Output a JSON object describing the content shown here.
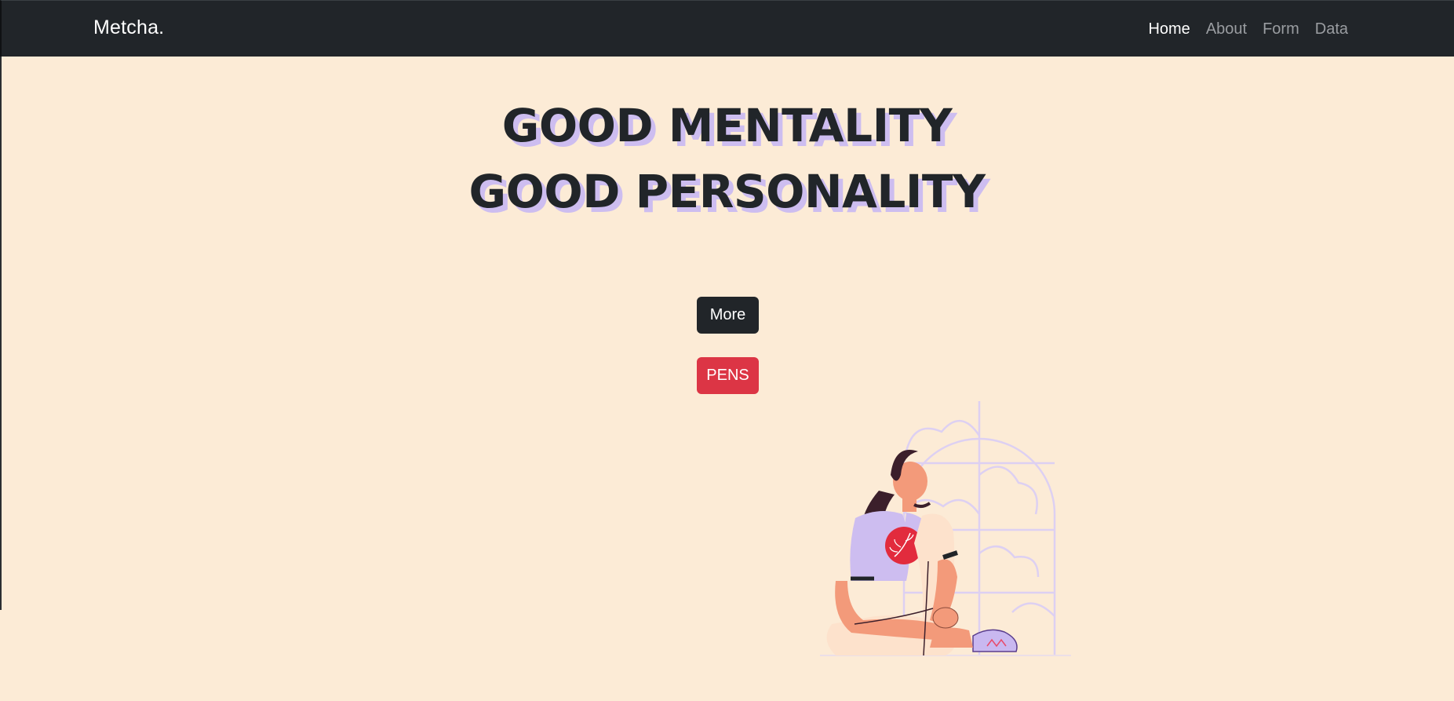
{
  "navbar": {
    "brand": "Metcha.",
    "links": [
      {
        "label": "Home",
        "active": true
      },
      {
        "label": "About",
        "active": false
      },
      {
        "label": "Form",
        "active": false
      },
      {
        "label": "Data",
        "active": false
      }
    ]
  },
  "hero": {
    "headline_line1": "GOOD MENTALITY",
    "headline_line2": "GOOD PERSONALITY",
    "more_button": "More",
    "pens_button": "PENS"
  },
  "colors": {
    "page_background": "#fcebd6",
    "navbar_background": "#212529",
    "headline_shadow": "#cdbdf0",
    "danger": "#dc3545",
    "dark": "#212529"
  },
  "illustration": {
    "icon": "woman-sitting-by-window-illustration"
  }
}
